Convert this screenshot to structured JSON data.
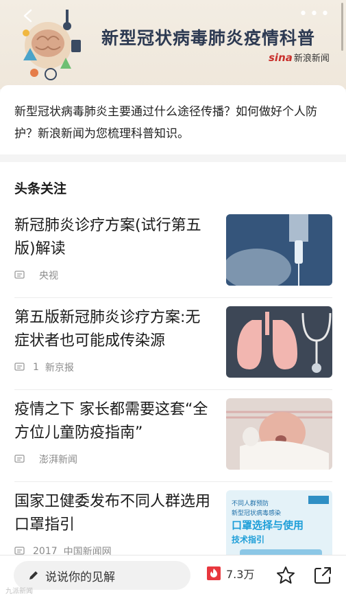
{
  "banner": {
    "title": "新型冠状病毒肺炎疫情科普",
    "logo_brand": "sina",
    "logo_sub": "新浪新闻"
  },
  "intro": {
    "text": "新型冠状病毒肺炎主要通过什么途径传播？如何做好个人防护？新浪新闻为您梳理科普知识。"
  },
  "feed": {
    "section_title": "头条关注",
    "items": [
      {
        "title": "新冠肺炎诊疗方案(试行第五版)解读",
        "comment_count": "",
        "source": "央视",
        "thumb_icon": "iv-drip-image"
      },
      {
        "title": "第五版新冠肺炎诊疗方案:无症状者也可能成传染源",
        "comment_count": "1",
        "source": "新京报",
        "thumb_icon": "lungs-stethoscope-image"
      },
      {
        "title": "疫情之下 家长都需要这套“全方位儿童防疫指南”",
        "comment_count": "",
        "source": "澎湃新闻",
        "thumb_icon": "newborn-baby-image"
      },
      {
        "title": "国家卫健委发布不同人群选用口罩指引",
        "comment_count": "2017",
        "source": "中国新闻网",
        "thumb_icon": "mask-guide-poster"
      }
    ],
    "poster_text": {
      "line1": "不同人群预防",
      "line2": "新型冠状病毒感染",
      "line3": "口罩选择与使用",
      "line4": "技术指引"
    }
  },
  "bottom_bar": {
    "comment_placeholder": "说说你的见解",
    "hot_count": "7.3万"
  },
  "watermark": "九派新闻",
  "colors": {
    "accent": "#e8373e",
    "banner_title": "#2d3a52",
    "meta_text": "#8a8a8a"
  }
}
